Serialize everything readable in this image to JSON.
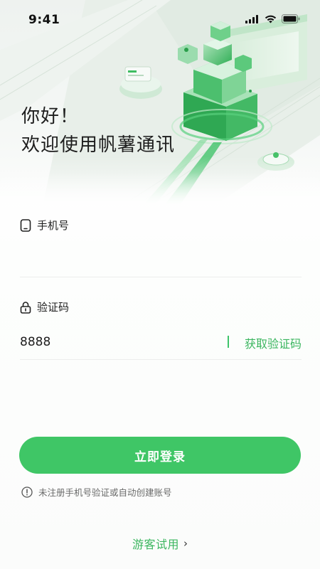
{
  "status_bar": {
    "time": "9:41",
    "icons": [
      "signal-icon",
      "wifi-icon",
      "battery-icon"
    ]
  },
  "greeting": {
    "line1": "你好！",
    "line2": "欢迎使用帆薯通讯"
  },
  "phone_field": {
    "label": "手机号",
    "value": "",
    "icon": "phone-icon"
  },
  "code_field": {
    "label": "验证码",
    "value": "8888",
    "icon": "lock-icon",
    "get_code_label": "获取验证码"
  },
  "login_button": {
    "label": "立即登录"
  },
  "notice": {
    "icon": "info-icon",
    "text": "未注册手机号验证或自动创建账号"
  },
  "guest": {
    "label": "游客试用",
    "chevron": "›"
  },
  "colors": {
    "accent": "#3fc666",
    "accent_text": "#3bb65f"
  }
}
